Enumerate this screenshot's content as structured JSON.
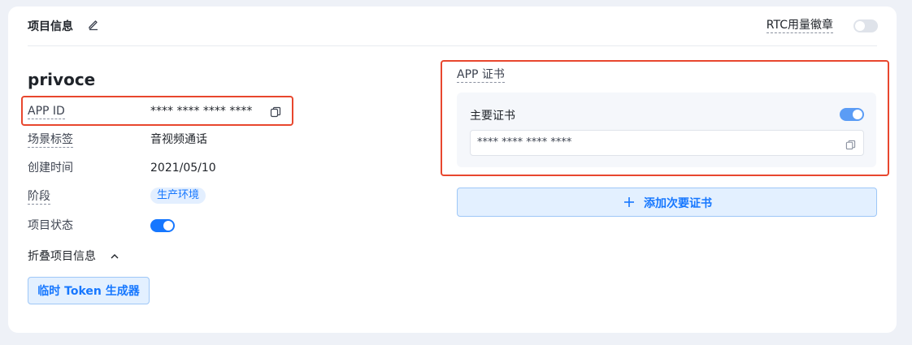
{
  "header": {
    "title": "项目信息",
    "rtc_badge_label": "RTC用量徽章",
    "rtc_badge_enabled": false
  },
  "project": {
    "name": "privoce",
    "rows": {
      "app_id": {
        "label": "APP ID",
        "value": "**** **** **** ****"
      },
      "scene_tag": {
        "label": "场景标签",
        "value": "音视频通话"
      },
      "created_time": {
        "label": "创建时间",
        "value": "2021/05/10"
      },
      "stage": {
        "label": "阶段",
        "value": "生产环境"
      },
      "status": {
        "label": "项目状态",
        "enabled": true
      }
    },
    "collapse_label": "折叠项目信息",
    "token_button_label": "临时 Token 生成器"
  },
  "certificate": {
    "title": "APP 证书",
    "primary_label": "主要证书",
    "primary_enabled": true,
    "primary_value": "**** **** **** ****",
    "add_secondary_label": "添加次要证书"
  },
  "colors": {
    "accent": "#1677ff",
    "highlight_border": "#e8472e",
    "page_background": "#eef1f7"
  },
  "icons": [
    "edit-icon",
    "copy-icon",
    "chevron-up-icon",
    "plus-icon"
  ]
}
